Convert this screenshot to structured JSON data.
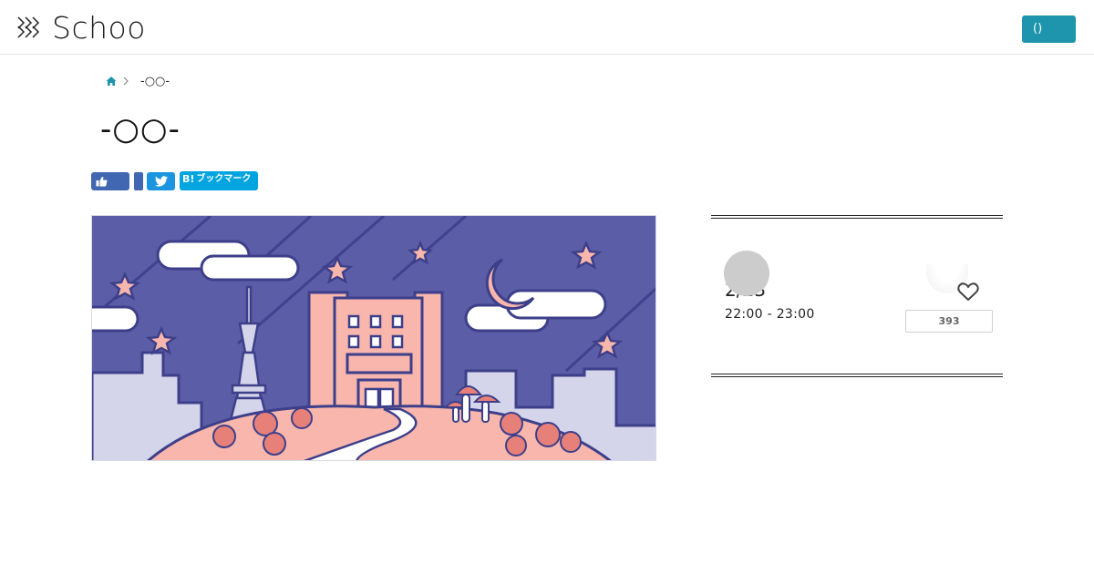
{
  "header": {
    "logo_text": "Schoo",
    "login_label": "()"
  },
  "breadcrumb": {
    "home_icon": "home-icon",
    "current": "-○○-"
  },
  "page": {
    "title": "-○○-"
  },
  "social": {
    "hatena_mark": "B!",
    "hatena_label": "ブックマーク",
    "colors": {
      "facebook": "#4267b2",
      "twitter": "#1b95e0",
      "hatena": "#00a4de"
    }
  },
  "class_info": {
    "date": "2/23",
    "time": "22:00 - 23:00",
    "favorite_count": "393"
  },
  "colors": {
    "accent": "#1f95ad",
    "hero_bg": "#5b5ea6",
    "hero_pink": "#f8b6ac"
  }
}
